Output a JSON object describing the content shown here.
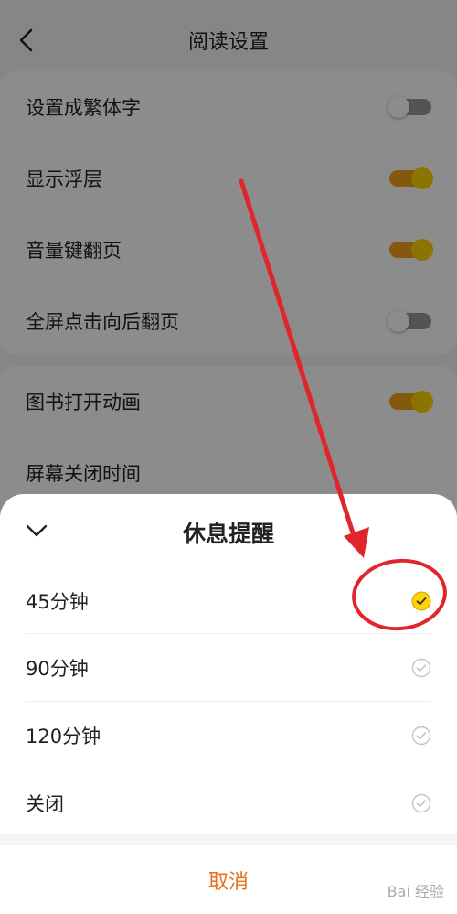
{
  "header": {
    "title": "阅读设置",
    "back_icon": "chevron-left-icon"
  },
  "settings": [
    {
      "label": "设置成繁体字",
      "enabled": false
    },
    {
      "label": "显示浮层",
      "enabled": true
    },
    {
      "label": "音量键翻页",
      "enabled": true
    },
    {
      "label": "全屏点击向后翻页",
      "enabled": false
    },
    {
      "label": "图书打开动画",
      "enabled": true
    },
    {
      "label": "屏幕关闭时间"
    }
  ],
  "sheet": {
    "title": "休息提醒",
    "collapse_icon": "chevron-down-icon",
    "options": [
      {
        "label": "45分钟",
        "selected": true
      },
      {
        "label": "90分钟",
        "selected": false
      },
      {
        "label": "120分钟",
        "selected": false
      },
      {
        "label": "关闭",
        "selected": false
      }
    ],
    "cancel_label": "取消"
  },
  "colors": {
    "accent": "#e8711a",
    "switch_on_track": "#f0a21a",
    "switch_on_knob": "#ffd400",
    "selected_radio": "#ffd400",
    "annotation_red": "#e0252b"
  },
  "watermark": "Bai 经验"
}
